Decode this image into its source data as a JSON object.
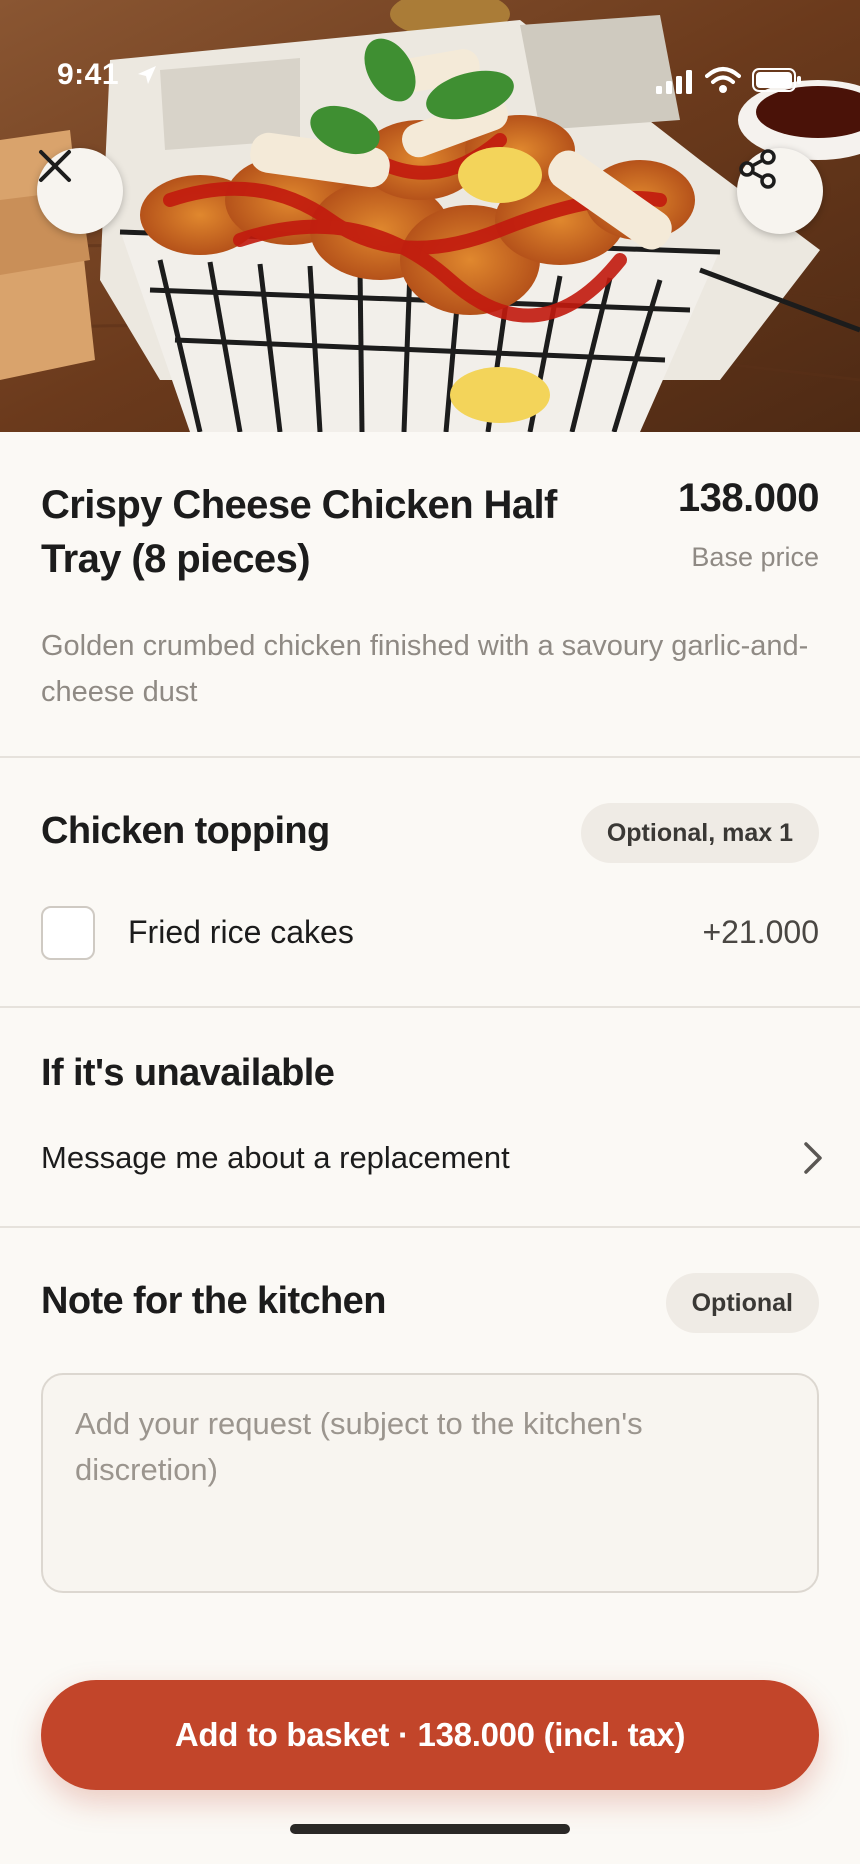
{
  "status_bar": {
    "time": "9:41"
  },
  "header": {
    "close_icon": "close-icon",
    "share_icon": "share-icon"
  },
  "product": {
    "title": "Crispy Cheese Chicken Half Tray (8 pieces)",
    "price": "138.000",
    "price_caption": "Base price",
    "description": "Golden crumbed chicken finished with a savoury garlic-and-cheese dust"
  },
  "topping": {
    "heading": "Chicken topping",
    "badge": "Optional, max 1",
    "options": [
      {
        "label": "Fried rice cakes",
        "price": "+21.000",
        "checked": false
      }
    ]
  },
  "unavailable": {
    "heading": "If it's unavailable",
    "selection": "Message me about a replacement"
  },
  "note": {
    "heading": "Note for the kitchen",
    "badge": "Optional",
    "placeholder": "Add your request (subject to the kitchen's discretion)"
  },
  "cta": {
    "label": "Add to basket · 138.000 (incl. tax)"
  },
  "colors": {
    "accent": "#c2452a",
    "background": "#fbf9f5",
    "muted_text": "#8f8a84"
  }
}
